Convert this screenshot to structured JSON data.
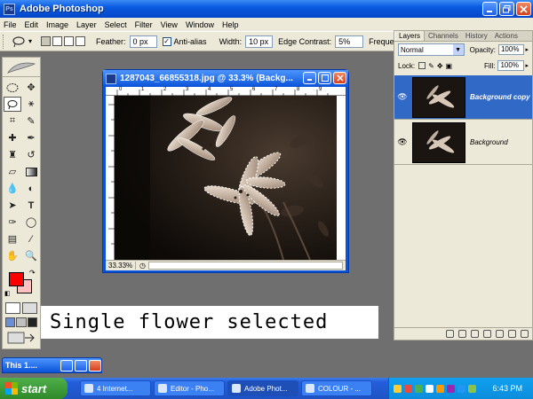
{
  "app": {
    "title": "Adobe Photoshop",
    "icon": "photoshop-icon"
  },
  "menu": [
    "File",
    "Edit",
    "Image",
    "Layer",
    "Select",
    "Filter",
    "View",
    "Window",
    "Help"
  ],
  "options": {
    "feather_label": "Feather:",
    "feather_value": "0 px",
    "antialias_label": "Anti-alias",
    "antialias_checked": true,
    "width_label": "Width:",
    "width_value": "10 px",
    "edge_label": "Edge Contrast:",
    "edge_value": "5%",
    "frequency_label": "Frequency:"
  },
  "toolbox": {
    "active_tool": "magnetic-lasso",
    "foreground_color": "#ff0000",
    "background_color": "#ffc0c0"
  },
  "document": {
    "title": "1287043_66855318.jpg @ 33.3% (Backg...",
    "zoom": "33.33%",
    "ruler_marks": [
      "0",
      "1",
      "2",
      "3",
      "4",
      "5",
      "6",
      "7",
      "8",
      "9"
    ]
  },
  "caption": "Single flower selected",
  "layers": {
    "tabs": [
      "Layers",
      "Channels",
      "History",
      "Actions"
    ],
    "active_tab": "Layers",
    "blend_mode": "Normal",
    "opacity_label": "Opacity:",
    "opacity": "100%",
    "lock_label": "Lock:",
    "fill_label": "Fill:",
    "fill": "100%",
    "items": [
      {
        "name": "Background copy",
        "selected": true
      },
      {
        "name": "Background",
        "selected": false
      }
    ]
  },
  "minimized_doc": {
    "title": "This 1...."
  },
  "taskbar": {
    "start_label": "start",
    "tasks": [
      {
        "label": "4 Internet...",
        "active": false
      },
      {
        "label": "Editor - Pho...",
        "active": false
      },
      {
        "label": "Adobe Phot...",
        "active": true
      },
      {
        "label": "COLOUR - ...",
        "active": false
      }
    ],
    "clock": "6:43 PM"
  }
}
